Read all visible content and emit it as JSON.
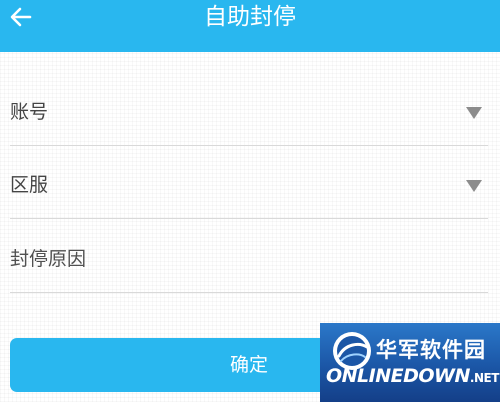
{
  "header": {
    "title": "自助封停",
    "back_icon": "back-arrow-icon"
  },
  "form": {
    "account": {
      "label": "账号",
      "icon": "dropdown-arrow-icon"
    },
    "server": {
      "label": "区服",
      "icon": "dropdown-arrow-icon"
    },
    "reason": {
      "placeholder": "封停原因"
    }
  },
  "actions": {
    "confirm_label": "确定"
  },
  "watermark": {
    "cn_text": "华军软件园",
    "en_text": "ONLINEDOWN",
    "en_suffix": ".NET"
  },
  "colors": {
    "accent": "#29b7ef",
    "text": "#444444",
    "divider": "#d9d9d9",
    "arrow": "#8c8c8c",
    "watermark_bg": "#1b56a6"
  }
}
